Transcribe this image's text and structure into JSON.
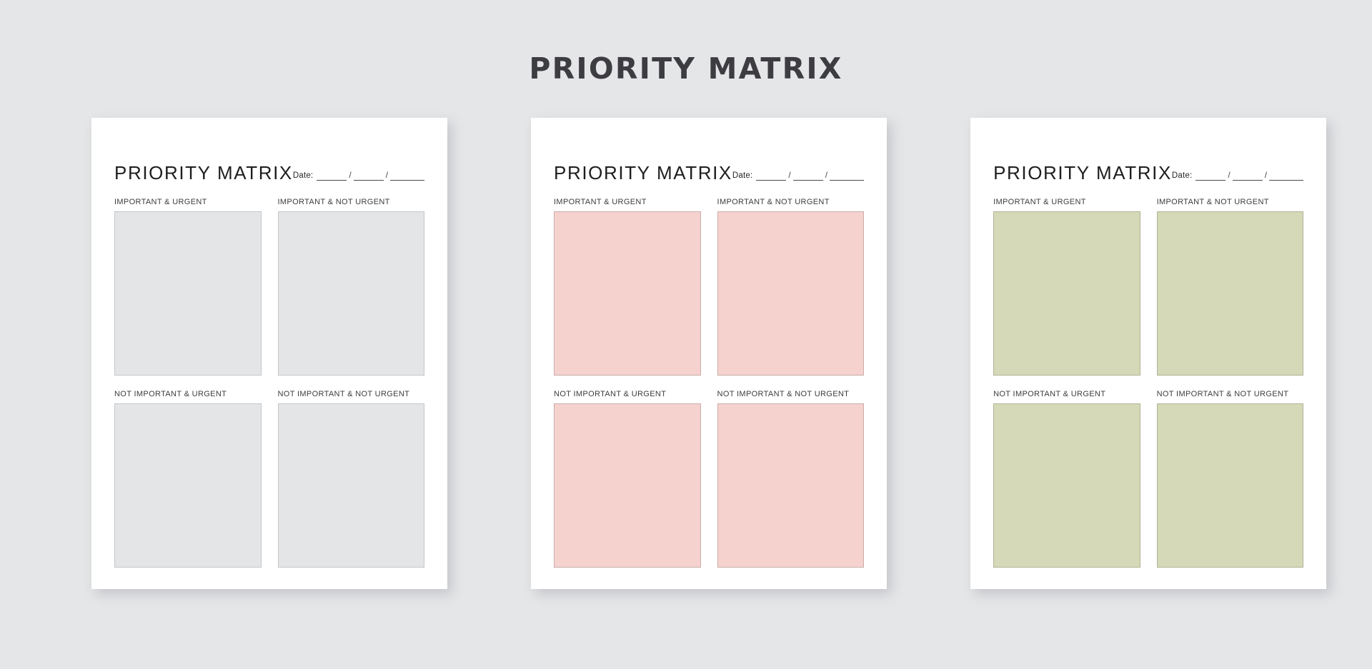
{
  "page": {
    "title": "PRIORITY MATRIX",
    "background_color": "#E5E6E8",
    "title_color": "#3D3D41"
  },
  "card_common": {
    "title": "PRIORITY MATRIX",
    "date_label": "Date:",
    "date_separator": "/",
    "quadrant_labels": {
      "important_urgent": "IMPORTANT & URGENT",
      "important_not_urgent": "IMPORTANT & NOT URGENT",
      "not_important_urgent": "NOT IMPORTANT & URGENT",
      "not_important_not_urgent": "NOT IMPORTANT & NOT URGENT"
    }
  },
  "cards": [
    {
      "theme": "gray",
      "title": "PRIORITY MATRIX",
      "date_label": "Date:",
      "fill_color": "#E4E5E7",
      "border_color": "#C4C6C8",
      "quadrants": [
        {
          "label": "IMPORTANT & URGENT",
          "value": ""
        },
        {
          "label": "IMPORTANT & NOT URGENT",
          "value": ""
        },
        {
          "label": "NOT IMPORTANT & URGENT",
          "value": ""
        },
        {
          "label": "NOT IMPORTANT & NOT URGENT",
          "value": ""
        }
      ]
    },
    {
      "theme": "pink",
      "title": "PRIORITY MATRIX",
      "date_label": "Date:",
      "fill_color": "#F5D2CE",
      "border_color": "#C9AEAB",
      "quadrants": [
        {
          "label": "IMPORTANT & URGENT",
          "value": ""
        },
        {
          "label": "IMPORTANT & NOT URGENT",
          "value": ""
        },
        {
          "label": "NOT IMPORTANT & URGENT",
          "value": ""
        },
        {
          "label": "NOT IMPORTANT & NOT URGENT",
          "value": ""
        }
      ]
    },
    {
      "theme": "green",
      "title": "PRIORITY MATRIX",
      "date_label": "Date:",
      "fill_color": "#D6D9B8",
      "border_color": "#B1B495",
      "quadrants": [
        {
          "label": "IMPORTANT & URGENT",
          "value": ""
        },
        {
          "label": "IMPORTANT & NOT URGENT",
          "value": ""
        },
        {
          "label": "NOT IMPORTANT & URGENT",
          "value": ""
        },
        {
          "label": "NOT IMPORTANT & NOT URGENT",
          "value": ""
        }
      ]
    }
  ]
}
